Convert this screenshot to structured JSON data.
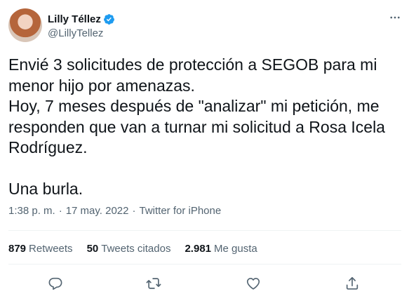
{
  "author": {
    "display_name": "Lilly Téllez",
    "handle": "@LillyTellez",
    "verified": true
  },
  "tweet": {
    "text": "Envié 3 solicitudes de protección a SEGOB para mi\nmenor hijo por amenazas.\nHoy, 7 meses después de \"analizar\" mi petición, me\nresponden que van a turnar mi solicitud a Rosa Icela\nRodríguez.\n\nUna burla.",
    "time": "1:38 p. m.",
    "separator": "·",
    "date": "17 may. 2022",
    "source": "Twitter for iPhone"
  },
  "stats": {
    "retweets_count": "879",
    "retweets_label": "Retweets",
    "quotes_count": "50",
    "quotes_label": "Tweets citados",
    "likes_count": "2.981",
    "likes_label": "Me gusta"
  },
  "icons": {
    "reply": "reply-icon",
    "retweet": "retweet-icon",
    "like": "like-icon",
    "share": "share-icon",
    "verified": "verified-badge-icon",
    "more": "more-icon"
  },
  "colors": {
    "verified_blue": "#1d9bf0",
    "secondary_text": "#536471",
    "primary_text": "#0f1419"
  }
}
